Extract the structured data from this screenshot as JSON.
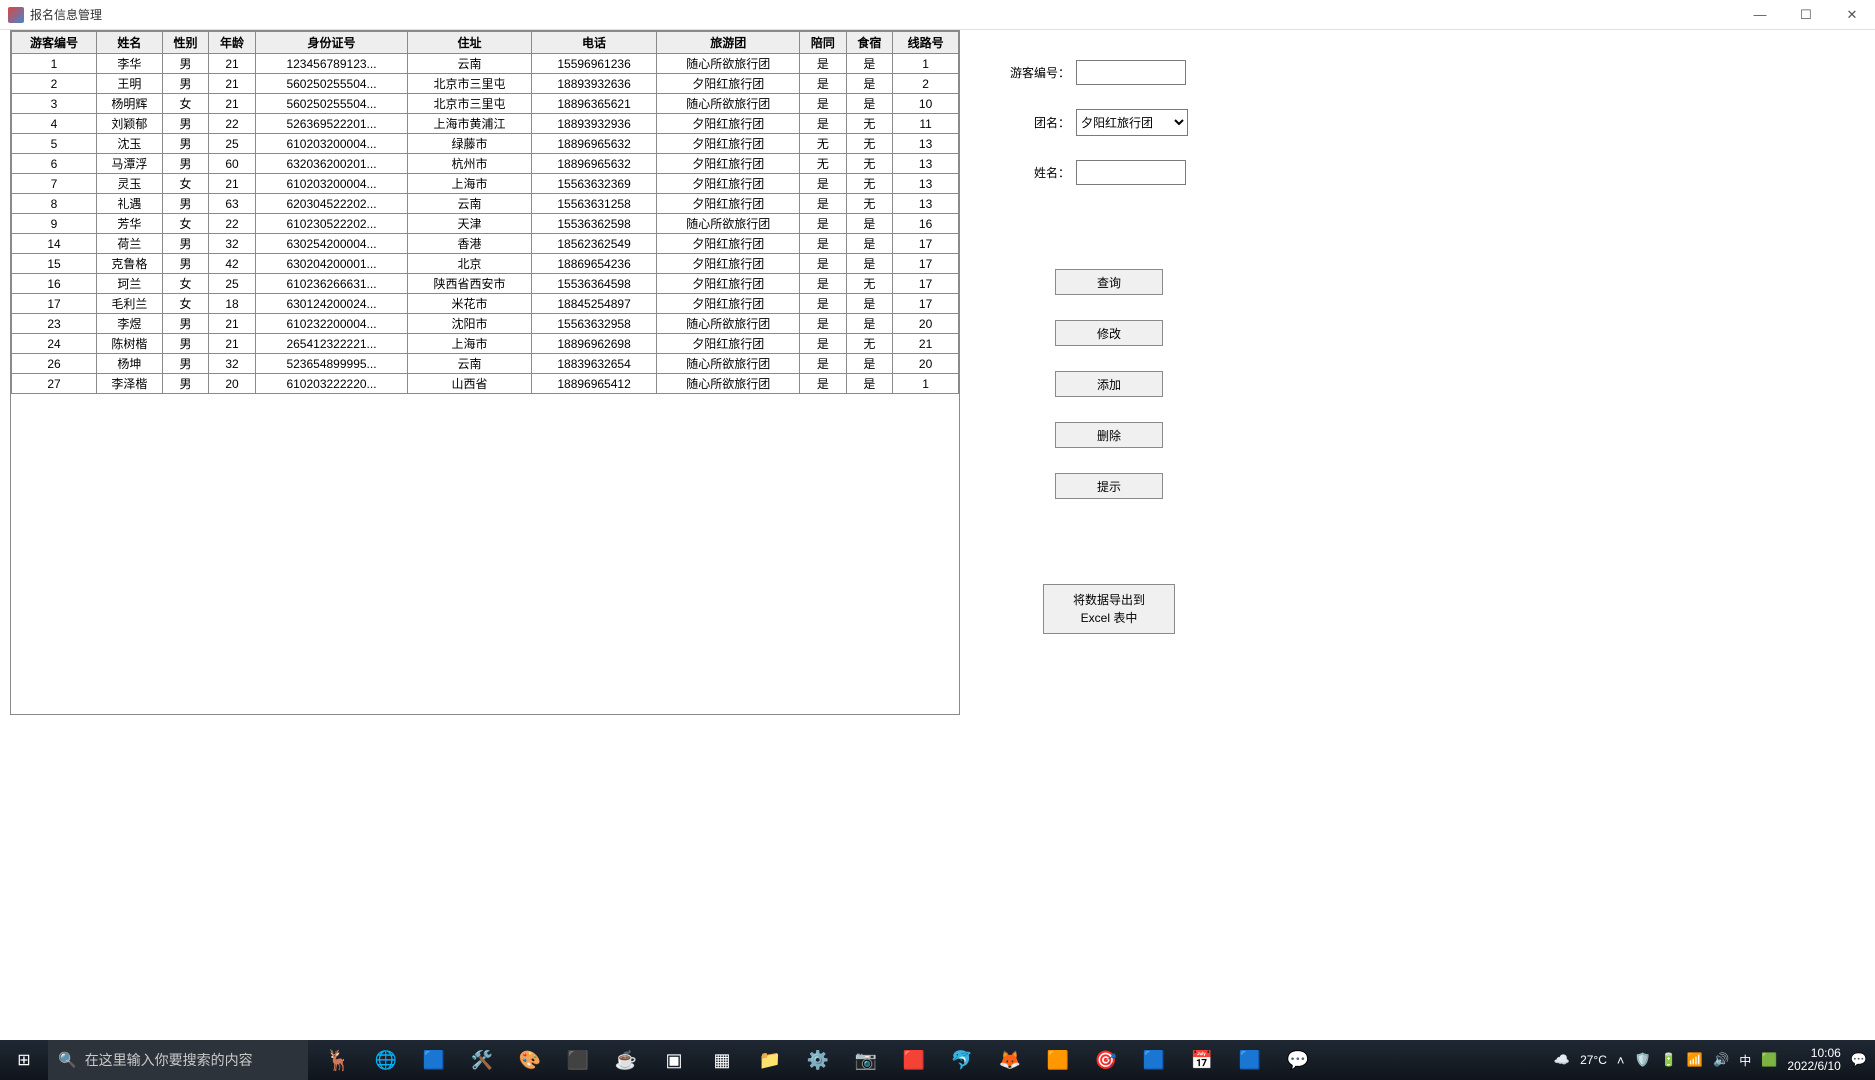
{
  "window": {
    "title": "报名信息管理"
  },
  "table": {
    "headers": [
      "游客编号",
      "姓名",
      "性别",
      "年龄",
      "身份证号",
      "住址",
      "电话",
      "旅游团",
      "陪同",
      "食宿",
      "线路号"
    ],
    "rows": [
      [
        "1",
        "李华",
        "男",
        "21",
        "123456789123...",
        "云南",
        "15596961236",
        "随心所欲旅行团",
        "是",
        "是",
        "1"
      ],
      [
        "2",
        "王明",
        "男",
        "21",
        "560250255504...",
        "北京市三里屯",
        "18893932636",
        "夕阳红旅行团",
        "是",
        "是",
        "2"
      ],
      [
        "3",
        "杨明辉",
        "女",
        "21",
        "560250255504...",
        "北京市三里屯",
        "18896365621",
        "随心所欲旅行团",
        "是",
        "是",
        "10"
      ],
      [
        "4",
        "刘颖郁",
        "男",
        "22",
        "526369522201...",
        "上海市黄浦江",
        "18893932936",
        "夕阳红旅行团",
        "是",
        "无",
        "11"
      ],
      [
        "5",
        "沈玉",
        "男",
        "25",
        "610203200004...",
        "绿藤市",
        "18896965632",
        "夕阳红旅行团",
        "无",
        "无",
        "13"
      ],
      [
        "6",
        "马潭浮",
        "男",
        "60",
        "632036200201...",
        "杭州市",
        "18896965632",
        "夕阳红旅行团",
        "无",
        "无",
        "13"
      ],
      [
        "7",
        "灵玉",
        "女",
        "21",
        "610203200004...",
        "上海市",
        "15563632369",
        "夕阳红旅行团",
        "是",
        "无",
        "13"
      ],
      [
        "8",
        "礼遇",
        "男",
        "63",
        "620304522202...",
        "云南",
        "15563631258",
        "夕阳红旅行团",
        "是",
        "无",
        "13"
      ],
      [
        "9",
        "芳华",
        "女",
        "22",
        "610230522202...",
        "天津",
        "15536362598",
        "随心所欲旅行团",
        "是",
        "是",
        "16"
      ],
      [
        "14",
        "荷兰",
        "男",
        "32",
        "630254200004...",
        "香港",
        "18562362549",
        "夕阳红旅行团",
        "是",
        "是",
        "17"
      ],
      [
        "15",
        "克鲁格",
        "男",
        "42",
        "630204200001...",
        "北京",
        "18869654236",
        "夕阳红旅行团",
        "是",
        "是",
        "17"
      ],
      [
        "16",
        "珂兰",
        "女",
        "25",
        "610236266631...",
        "陕西省西安市",
        "15536364598",
        "夕阳红旅行团",
        "是",
        "无",
        "17"
      ],
      [
        "17",
        "毛利兰",
        "女",
        "18",
        "630124200024...",
        "米花市",
        "18845254897",
        "夕阳红旅行团",
        "是",
        "是",
        "17"
      ],
      [
        "23",
        "李煜",
        "男",
        "21",
        "610232200004...",
        "沈阳市",
        "15563632958",
        "随心所欲旅行团",
        "是",
        "是",
        "20"
      ],
      [
        "24",
        "陈树楷",
        "男",
        "21",
        "265412322221...",
        "上海市",
        "18896962698",
        "夕阳红旅行团",
        "是",
        "无",
        "21"
      ],
      [
        "26",
        "杨坤",
        "男",
        "32",
        "523654899995...",
        "云南",
        "18839632654",
        "随心所欲旅行团",
        "是",
        "是",
        "20"
      ],
      [
        "27",
        "李泽楷",
        "男",
        "20",
        "610203222220...",
        "山西省",
        "18896965412",
        "随心所欲旅行团",
        "是",
        "是",
        "1"
      ]
    ]
  },
  "side": {
    "tourist_id_label": "游客编号：",
    "group_label": "团名：",
    "name_label": "姓名：",
    "tourist_id_value": "",
    "name_value": "",
    "group_selected": "夕阳红旅行团",
    "buttons": {
      "query": "查询",
      "modify": "修改",
      "add": "添加",
      "delete": "删除",
      "hint": "提示",
      "export_l1": "将数据导出到",
      "export_l2": "Excel 表中"
    }
  },
  "taskbar": {
    "search_placeholder": "在这里输入你要搜索的内容",
    "weather": "27°C",
    "time": "10:06",
    "date": "2022/6/10",
    "ime": "中"
  }
}
